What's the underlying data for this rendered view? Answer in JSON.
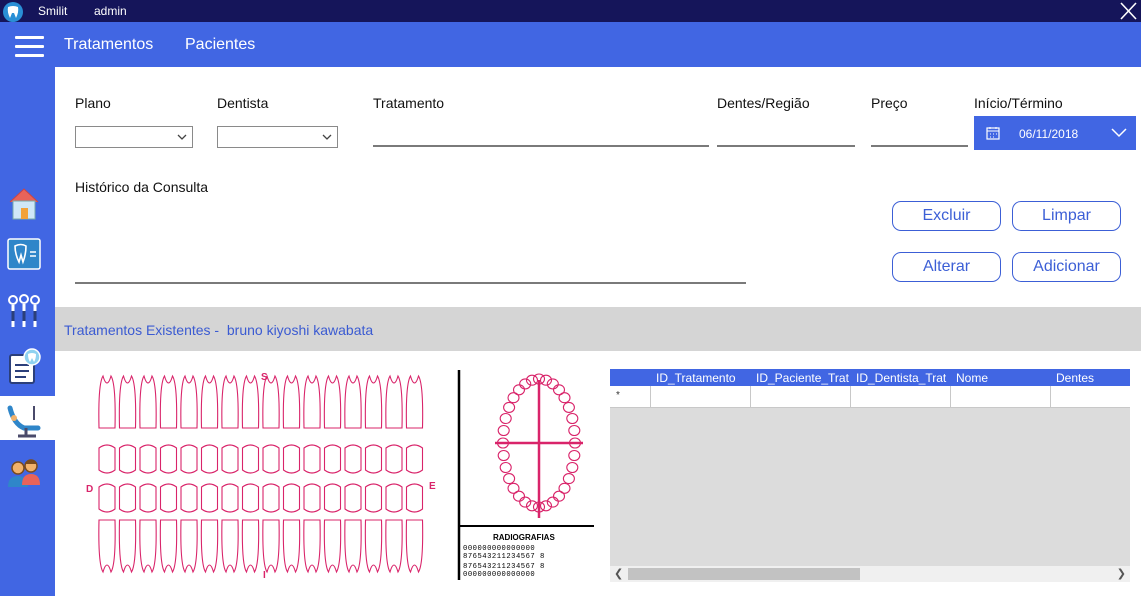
{
  "titlebar": {
    "app_name": "Smilit",
    "user": "admin"
  },
  "topbar": {
    "nav": [
      "Tratamentos",
      "Pacientes"
    ]
  },
  "sidebar": {
    "items": [
      "home-icon",
      "dental-xray-icon",
      "dental-tools-icon",
      "dental-record-icon",
      "dentist-chair-icon",
      "patients-icon"
    ],
    "active_index": 4
  },
  "form": {
    "plano_label": "Plano",
    "dentista_label": "Dentista",
    "tratamento_label": "Tratamento",
    "dentes_label": "Dentes/Região",
    "preco_label": "Preço",
    "inicio_label": "Início/Término",
    "date_value": "06/11/2018",
    "historico_label": "Histórico da Consulta"
  },
  "buttons": {
    "excluir": "Excluir",
    "limpar": "Limpar",
    "alterar": "Alterar",
    "adicionar": "Adicionar"
  },
  "banner": {
    "prefix": "Tratamentos Existentes -",
    "patient": "bruno kiyoshi kawabata"
  },
  "dental_chart": {
    "upper_marker": "S",
    "lower_marker": "I",
    "left_marker": "D",
    "right_marker": "E"
  },
  "radiografias": {
    "title": "RADIOGRAFIAS",
    "rows": [
      "000000000000000",
      "876543211234567 8",
      "876543211234567 8",
      "000000000000000"
    ]
  },
  "grid": {
    "columns": [
      "ID_Tratamento",
      "ID_Paciente_Trat",
      "ID_Dentista_Trat",
      "Nome",
      "Dentes"
    ],
    "new_row_marker": "*"
  },
  "colors": {
    "primary": "#4166e3",
    "titlebar": "#15155a",
    "tooth": "#d9246a",
    "accent_text": "#3b5bd2"
  }
}
